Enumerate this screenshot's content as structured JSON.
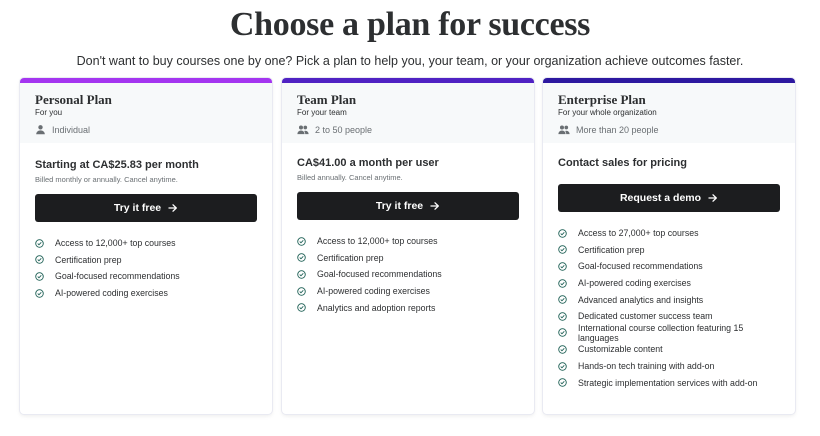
{
  "page": {
    "title": "Choose a plan for success",
    "subtitle": "Don't want to buy courses one by one? Pick a plan to help you, your team, or your organization achieve outcomes faster."
  },
  "colors": {
    "personal_accent": "#a435f0",
    "team_accent": "#5022c3",
    "enterprise_accent": "#2d18a0",
    "check": "#1e6055",
    "button_bg": "#1c1d1f"
  },
  "plans": [
    {
      "name": "Personal Plan",
      "for": "For you",
      "size_icon": "person-icon",
      "size": "Individual",
      "price": "Starting at CA$25.83 per month",
      "billing": "Billed monthly or annually. Cancel anytime.",
      "cta": "Try it free",
      "features": [
        "Access to 12,000+ top courses",
        "Certification prep",
        "Goal-focused recommendations",
        "AI-powered coding exercises"
      ]
    },
    {
      "name": "Team Plan",
      "for": "For your team",
      "size_icon": "people-icon",
      "size": "2 to 50 people",
      "price": "CA$41.00 a month per user",
      "billing": "Billed annually. Cancel anytime.",
      "cta": "Try it free",
      "features": [
        "Access to 12,000+ top courses",
        "Certification prep",
        "Goal-focused recommendations",
        "AI-powered coding exercises",
        "Analytics and adoption reports"
      ]
    },
    {
      "name": "Enterprise Plan",
      "for": "For your whole organization",
      "size_icon": "people-icon",
      "size": "More than 20 people",
      "price": "Contact sales for pricing",
      "billing": "",
      "cta": "Request a demo",
      "features": [
        "Access to 27,000+ top courses",
        "Certification prep",
        "Goal-focused recommendations",
        "AI-powered coding exercises",
        "Advanced analytics and insights",
        "Dedicated customer success team",
        "International course collection featuring 15 languages",
        "Customizable content",
        "Hands-on tech training with add-on",
        "Strategic implementation services with add-on"
      ]
    }
  ]
}
